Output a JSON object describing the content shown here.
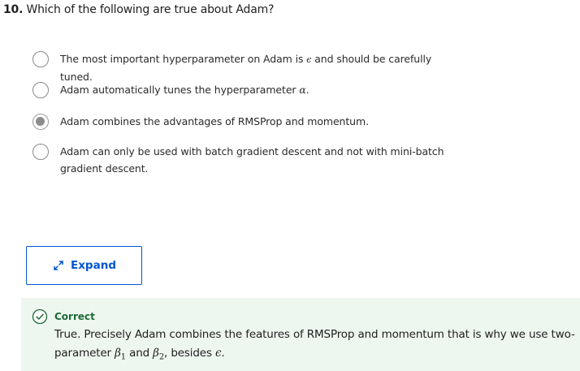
{
  "question": {
    "number": "10.",
    "text": "Which of the following are true about Adam?"
  },
  "options": [
    {
      "text_before": "The most important hyperparameter on Adam is ",
      "symbol": "ϵ",
      "text_after": " and should be carefully tuned.",
      "selected": false
    },
    {
      "text_before": "Adam automatically tunes the hyperparameter ",
      "symbol": "α",
      "text_after": ".",
      "selected": false
    },
    {
      "text_before": "Adam combines the advantages of RMSProp and momentum.",
      "symbol": "",
      "text_after": "",
      "selected": true
    },
    {
      "text_before": "Adam can only be used with batch gradient descent and not with mini-batch gradient descent.",
      "symbol": "",
      "text_after": "",
      "selected": false
    }
  ],
  "expand_button": {
    "label": "Expand",
    "icon": "expand-arrows-icon",
    "color": "#0056d2"
  },
  "feedback": {
    "status": "Correct",
    "status_color": "#1d6b36",
    "background": "#eef6f0",
    "text_1": "True. Precisely Adam combines the features of RMSProp and momentum that is why we use two-parameter ",
    "beta1_base": "β",
    "beta1_sub": "1",
    "text_2": " and ",
    "beta2_base": "β",
    "beta2_sub": "2",
    "text_3": ", besides ",
    "epsilon": "ϵ",
    "text_4": "."
  }
}
